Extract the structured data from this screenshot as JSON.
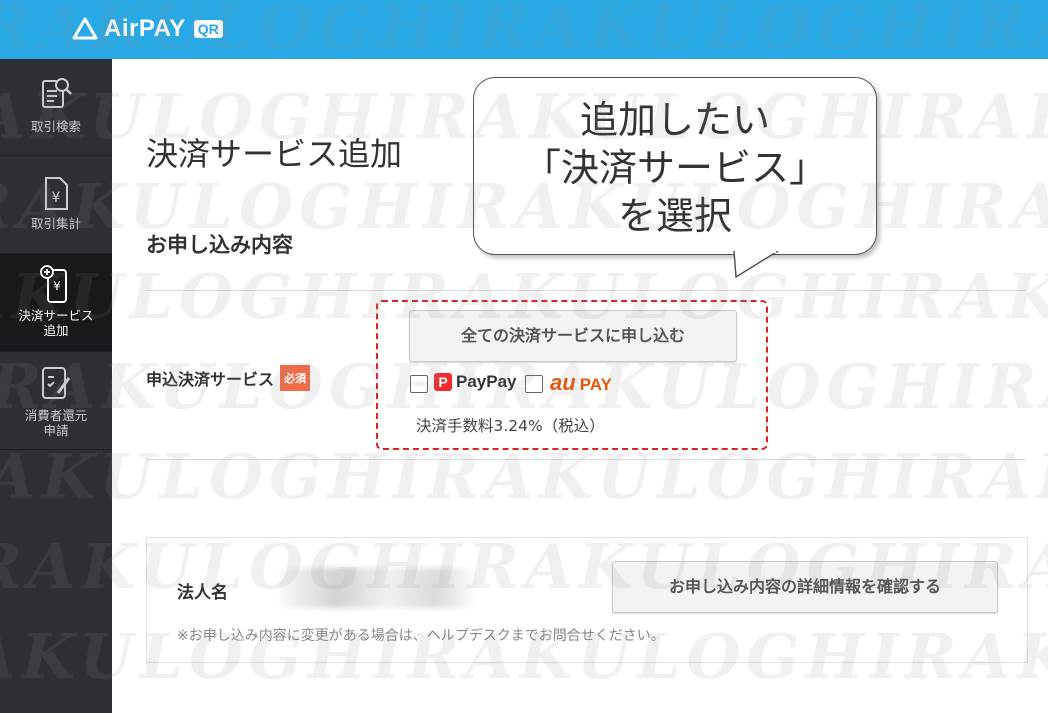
{
  "app": {
    "logo_text": "AirPAY",
    "logo_badge": "QR"
  },
  "sidebar": {
    "items": [
      {
        "label": "取引検索",
        "icon": "search-document-icon",
        "active": false
      },
      {
        "label": "取引集計",
        "icon": "yen-document-icon",
        "active": false
      },
      {
        "label": "決済サービス\n追加",
        "icon": "phone-yen-add-icon",
        "active": true
      },
      {
        "label": "消費者還元\n申請",
        "icon": "document-edit-icon",
        "active": false
      }
    ]
  },
  "main": {
    "page_title": "決済サービス追加",
    "section_title": "お申し込み内容",
    "apply_label": "申込決済サービス",
    "required_badge": "必須",
    "apply_all_button": "全ての決済サービスに申し込む",
    "options": [
      {
        "name": "PayPay",
        "mark": "P",
        "checked": false
      },
      {
        "name_au": "au",
        "name_pay": "PAY",
        "checked": false
      }
    ],
    "fee_text": "決済手数料3.24%（税込）",
    "corp_label": "法人名",
    "detail_button": "お申し込み内容の詳細情報を確認する",
    "note": "※お申し込み内容に変更がある場合は、ヘルプデスクまでお問合せください。"
  },
  "callout": {
    "line1": "追加したい",
    "line2": "「決済サービス」",
    "line3": "を選択"
  },
  "watermark": {
    "text": "RAKULOGHIRAKULOGHIRAKULO"
  },
  "colors": {
    "header": "#28a9e6",
    "sidebar": "#2d3136",
    "sidebar_active": "#17191c",
    "required": "#ef6b47",
    "highlight": "#e02020",
    "paypay": "#f02c2c",
    "aupay": "#eb5505"
  }
}
